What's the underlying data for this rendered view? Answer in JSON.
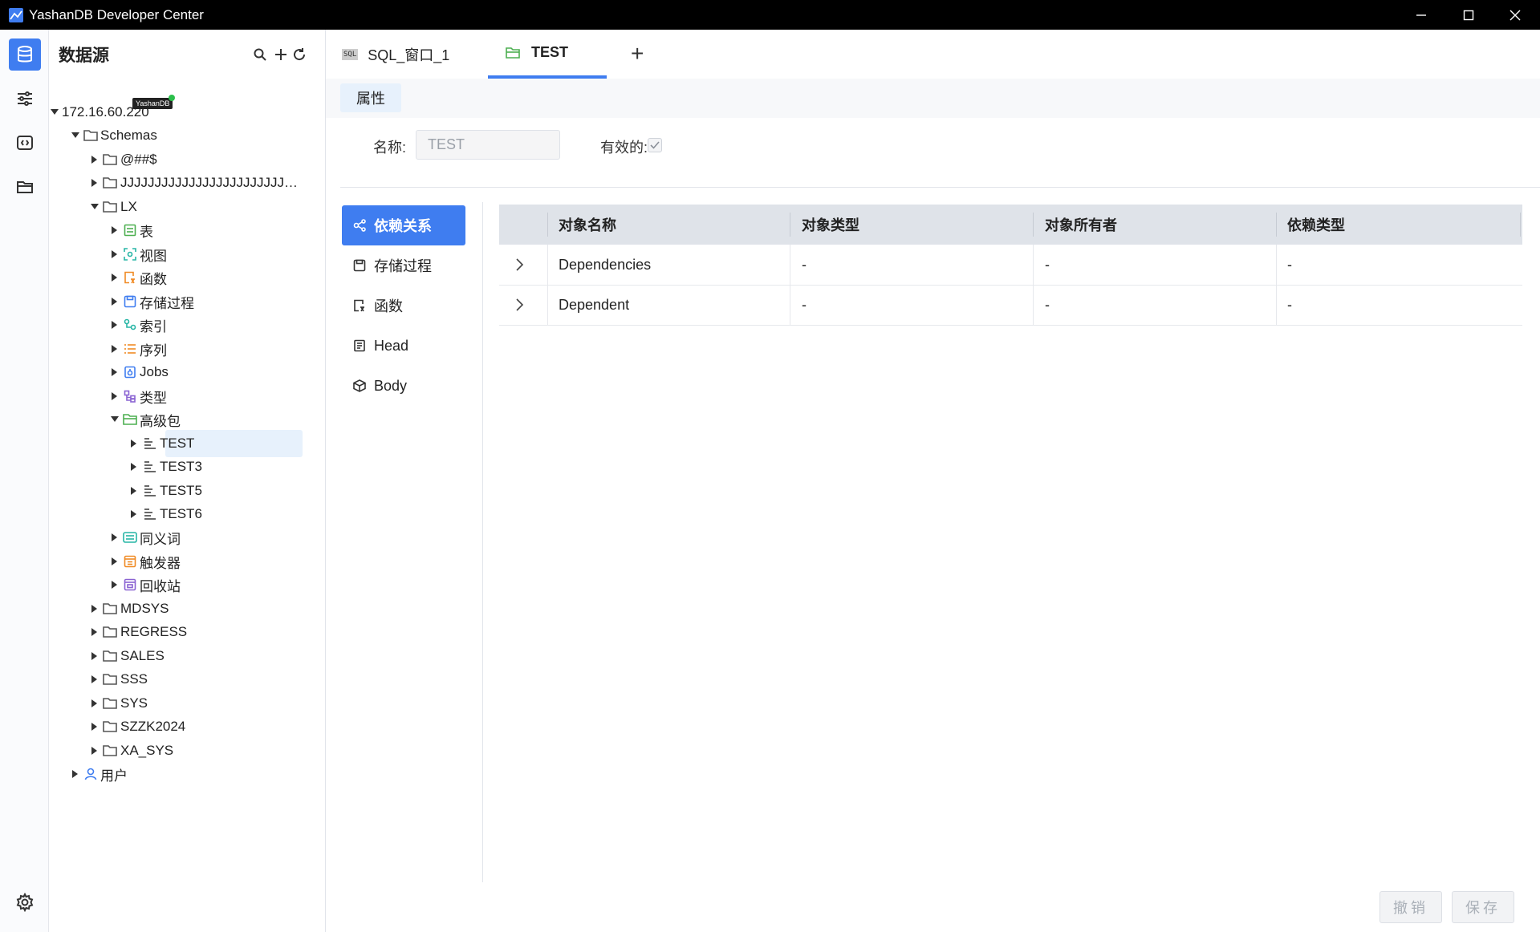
{
  "window": {
    "title": "YashanDB Developer Center"
  },
  "sidebar": {
    "title": "数据源",
    "rail_icons": [
      "database-icon",
      "sliders-icon",
      "code-icon",
      "folder-icon",
      "gear-icon"
    ]
  },
  "tree": {
    "connection": "172.16.60.220",
    "connection_badge": "YashanDB",
    "schemas_label": "Schemas",
    "schema1": "@##$",
    "schema2": "JJJJJJJJJJJJJJJJJJJJJJJJ…",
    "schema_lx": "LX",
    "lx_children": [
      "表",
      "视图",
      "函数",
      "存储过程",
      "索引",
      "序列",
      "Jobs",
      "类型",
      "高级包"
    ],
    "packages": [
      "TEST",
      "TEST3",
      "TEST5",
      "TEST6"
    ],
    "lx_after": [
      "同义词",
      "触发器",
      "回收站"
    ],
    "other_schemas": [
      "MDSYS",
      "REGRESS",
      "SALES",
      "SSS",
      "SYS",
      "SZZK2024",
      "XA_SYS"
    ],
    "users_label": "用户"
  },
  "tabs": [
    {
      "label": "SQL_窗口_1",
      "icon_text": "SQL"
    },
    {
      "label": "TEST"
    }
  ],
  "props": {
    "subtab": "属性",
    "name_label": "名称:",
    "name_value": "TEST",
    "valid_label": "有效的:"
  },
  "menu": [
    "依赖关系",
    "存储过程",
    "函数",
    "Head",
    "Body"
  ],
  "table": {
    "columns": [
      "对象名称",
      "对象类型",
      "对象所有者",
      "依赖类型"
    ],
    "rows": [
      [
        "Dependencies",
        "-",
        "-",
        "-"
      ],
      [
        "Dependent",
        "-",
        "-",
        "-"
      ]
    ]
  },
  "buttons": {
    "cancel": "撤销",
    "save": "保存"
  },
  "colors": {
    "accent": "#3f7df0",
    "selected_bg": "#e7f1fc",
    "status_online": "#2bbf4b"
  }
}
